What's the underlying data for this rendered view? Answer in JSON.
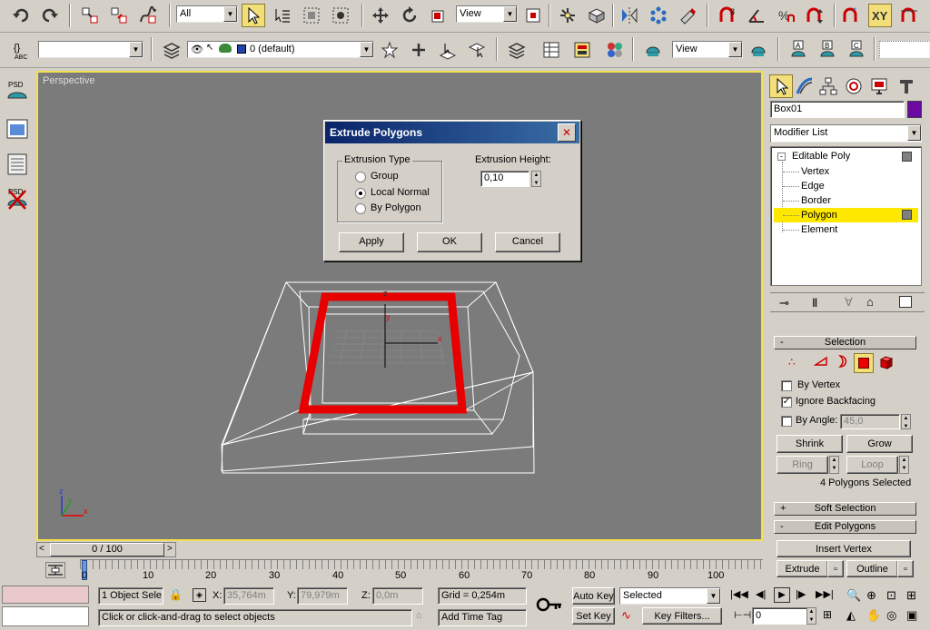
{
  "toolbar1": {
    "filter_select": "All",
    "refcoord_select": "View"
  },
  "toolbar2": {
    "named_selection": "",
    "layer_select": "0 (default)",
    "view_select": "View",
    "abc_label": "ABC"
  },
  "left_tools": {
    "psd1": "PSD",
    "psd2": "PSD"
  },
  "viewport": {
    "label": "Perspective",
    "axis_x": "x",
    "axis_y": "y",
    "axis_z": "z"
  },
  "dialog": {
    "title": "Extrude Polygons",
    "group_label": "Extrusion Type",
    "options": [
      "Group",
      "Local Normal",
      "By Polygon"
    ],
    "selected_option": 1,
    "height_label": "Extrusion Height:",
    "height_value": "0,10",
    "apply": "Apply",
    "ok": "OK",
    "cancel": "Cancel",
    "close_glyph": "✕"
  },
  "command_panel": {
    "object_name": "Box01",
    "object_color": "#6a0aa0",
    "modifier_list": "Modifier List",
    "stack_root": "Editable Poly",
    "stack_items": [
      "Vertex",
      "Edge",
      "Border",
      "Polygon",
      "Element"
    ],
    "stack_selected": "Polygon",
    "selection_rollout": "Selection",
    "by_vertex": "By Vertex",
    "ignore_backfacing": "Ignore Backfacing",
    "by_angle": "By Angle:",
    "angle_value": "45,0",
    "shrink": "Shrink",
    "grow": "Grow",
    "ring": "Ring",
    "loop": "Loop",
    "selected_count": "4 Polygons Selected",
    "soft_selection": "Soft Selection",
    "edit_polygons": "Edit Polygons",
    "insert_vertex": "Insert Vertex",
    "extrude": "Extrude",
    "outline": "Outline",
    "rollout_plus": "+",
    "rollout_minus": "-"
  },
  "timeline": {
    "slider_label": "0 / 100",
    "ticks": [
      "0",
      "10",
      "20",
      "30",
      "40",
      "50",
      "60",
      "70",
      "80",
      "90",
      "100"
    ]
  },
  "status": {
    "selection": "1 Object Sele",
    "x_label": "X:",
    "x_value": "35,764m",
    "y_label": "Y:",
    "y_value": "79,979m",
    "z_label": "Z:",
    "z_value": "0,0m",
    "grid": "Grid = 0,254m",
    "prompt": "Click or click-and-drag to select objects",
    "add_time_tag": "Add Time Tag",
    "auto_key": "Auto Key",
    "set_key": "Set Key",
    "key_mode": "Selected",
    "key_filters": "Key Filters...",
    "frame": "0"
  },
  "colors": {
    "viewport_bg": "#7b7b7b",
    "active_border": "#f2e050",
    "selection_red": "#e80000",
    "dialog_title_start": "#0a246a",
    "dialog_title_end": "#a6caf0",
    "stack_highlight": "#ffe800"
  }
}
